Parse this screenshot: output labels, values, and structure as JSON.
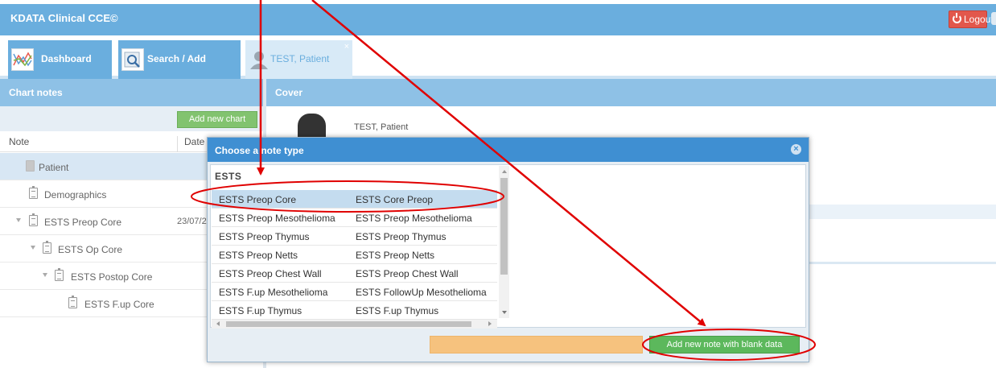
{
  "app": {
    "title": "KDATA Clinical CCE©",
    "logout_label": "Logout"
  },
  "tabs": {
    "dashboard": "Dashboard",
    "search": "Search / Add",
    "patient": "TEST, Patient",
    "close": "×"
  },
  "chart_notes": {
    "title": "Chart notes",
    "add_button": "Add new chart",
    "col_note": "Note",
    "col_date": "Date",
    "rows": [
      {
        "label": "Patient",
        "date": ""
      },
      {
        "label": "Demographics",
        "date": ""
      },
      {
        "label": "ESTS Preop Core",
        "date": "23/07/2"
      },
      {
        "label": "ESTS Op Core",
        "date": ""
      },
      {
        "label": "ESTS Postop Core",
        "date": ""
      },
      {
        "label": "ESTS F.up Core",
        "date": ""
      }
    ]
  },
  "cover": {
    "title": "Cover",
    "patient_name": "TEST, Patient"
  },
  "modal": {
    "title": "Choose a note type",
    "close": "×",
    "group": "ESTS",
    "items": [
      {
        "name": "ESTS Preop Core",
        "desc": "ESTS Core Preop"
      },
      {
        "name": "ESTS Preop Mesothelioma",
        "desc": "ESTS Preop Mesothelioma"
      },
      {
        "name": "ESTS Preop Thymus",
        "desc": "ESTS Preop Thymus"
      },
      {
        "name": "ESTS Preop Netts",
        "desc": "ESTS Preop Netts"
      },
      {
        "name": "ESTS Preop Chest Wall",
        "desc": "ESTS Preop Chest Wall"
      },
      {
        "name": "ESTS F.up Mesothelioma",
        "desc": "ESTS FollowUp Mesothelioma"
      },
      {
        "name": "ESTS F.up Thymus",
        "desc": "ESTS F.up Thymus"
      }
    ],
    "blank_button": "Add new note with blank data"
  },
  "colors": {
    "header": "#6aaede",
    "accent_red": "#e2574c",
    "green": "#5cb85c",
    "annotation": "#e00000"
  },
  "icons": [
    "power-icon",
    "dashboard-chart-icon",
    "search-magnifier-icon",
    "patient-avatar-icon",
    "document-icon",
    "close-circle-icon"
  ]
}
